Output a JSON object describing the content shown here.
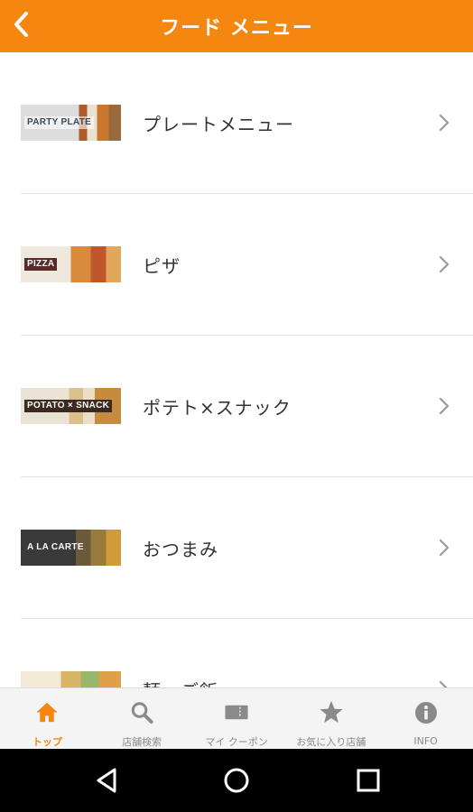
{
  "header": {
    "title": "フード メニュー"
  },
  "menu_items": [
    {
      "label": "プレートメニュー",
      "thumb_text": "PARTY PLATE"
    },
    {
      "label": "ピザ",
      "thumb_text": "PIZZA"
    },
    {
      "label": "ポテト×スナック",
      "thumb_text": "POTATO × SNACK"
    },
    {
      "label": "おつまみ",
      "thumb_text": "A LA CARTE"
    },
    {
      "label": "麺・ご飯",
      "thumb_text": ""
    }
  ],
  "tabs": [
    {
      "label": "トップ",
      "icon": "home-icon",
      "active": true
    },
    {
      "label": "店舗検索",
      "icon": "search-icon",
      "active": false
    },
    {
      "label": "マイ クーポン",
      "icon": "coupon-icon",
      "active": false
    },
    {
      "label": "お気に入り店舗",
      "icon": "star-icon",
      "active": false
    },
    {
      "label": "INFO",
      "icon": "info-icon",
      "active": false
    }
  ],
  "colors": {
    "accent": "#f5860f",
    "tab_inactive": "#8a8a8a"
  }
}
